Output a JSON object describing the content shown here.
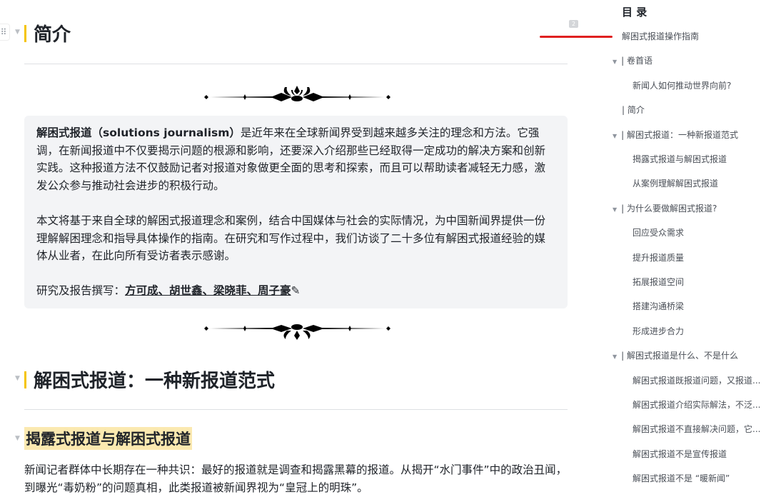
{
  "doc": {
    "h1_intro": "简介",
    "callout": {
      "p1_bold": "解困式报道（solutions journalism）",
      "p1_rest": "是近年来在全球新闻界受到越来越多关注的理念和方法。它强调，在新闻报道中不仅要揭示问题的根源和影响，还要深入介绍那些已经取得一定成功的解决方案和创新实践。这种报道方法不仅鼓励记者对报道对象做更全面的思考和探索，而且可以帮助读者减轻无力感，激发公众参与推动社会进步的积极行动。",
      "p2": "本文将基于来自全球的解困式报道理念和案例，结合中国媒体与社会的实际情况，为中国新闻界提供一份理解解困理念和指导具体操作的指南。在研究和写作过程中，我们访谈了二十多位有解困式报道经验的媒体从业者，在此向所有受访者表示感谢。",
      "authors_label": "研究及报告撰写：",
      "authors": "方可成、胡世鑫、梁晓菲、周子豪"
    },
    "h2_paradigm": "解困式报道：一种新报道范式",
    "h3_exposure": "揭露式报道与解困式报道",
    "para1": "新闻记者群体中长期存在一种共识：最好的报道就是调查和揭露黑幕的报道。从揭开“水门事件”中的政治丑闻，到曝光“毒奶粉”的问题真相，此类报道被新闻界视为“皇冠上的明珠”。"
  },
  "comment_badge": "2",
  "toc": {
    "title": "目 录",
    "items": [
      {
        "label": "解困式报道操作指南",
        "level": 0
      },
      {
        "label": "| 卷首语",
        "level": 1,
        "caret": true
      },
      {
        "label": "新闻人如何推动世界向前?",
        "level": 2
      },
      {
        "label": "| 简介",
        "level": 1
      },
      {
        "label": "| 解困式报道：一种新报道范式",
        "level": 1,
        "caret": true
      },
      {
        "label": "揭露式报道与解困式报道",
        "level": 2
      },
      {
        "label": "从案例理解解困式报道",
        "level": 2
      },
      {
        "label": "| 为什么要做解困式报道?",
        "level": 1,
        "caret": true
      },
      {
        "label": "回应受众需求",
        "level": 2
      },
      {
        "label": "提升报道质量",
        "level": 2
      },
      {
        "label": "拓展报道空间",
        "level": 2
      },
      {
        "label": "搭建沟通桥梁",
        "level": 2
      },
      {
        "label": "形成进步合力",
        "level": 2
      },
      {
        "label": "| 解困式报道是什么、不是什么",
        "level": 1,
        "caret": true
      },
      {
        "label": "解困式报道既报道问题，又报道...",
        "level": 2
      },
      {
        "label": "解困式报道介绍实际解法，不泛...",
        "level": 2
      },
      {
        "label": "解困式报道不直接解决问题，它...",
        "level": 2
      },
      {
        "label": "解困式报道不是宣传报道",
        "level": 2
      },
      {
        "label": "解困式报道不是 “暖新闻”",
        "level": 2
      }
    ]
  },
  "colors": {
    "accent": "#f5c400",
    "highlight": "#fbe9b0",
    "active_line": "#e02020"
  }
}
